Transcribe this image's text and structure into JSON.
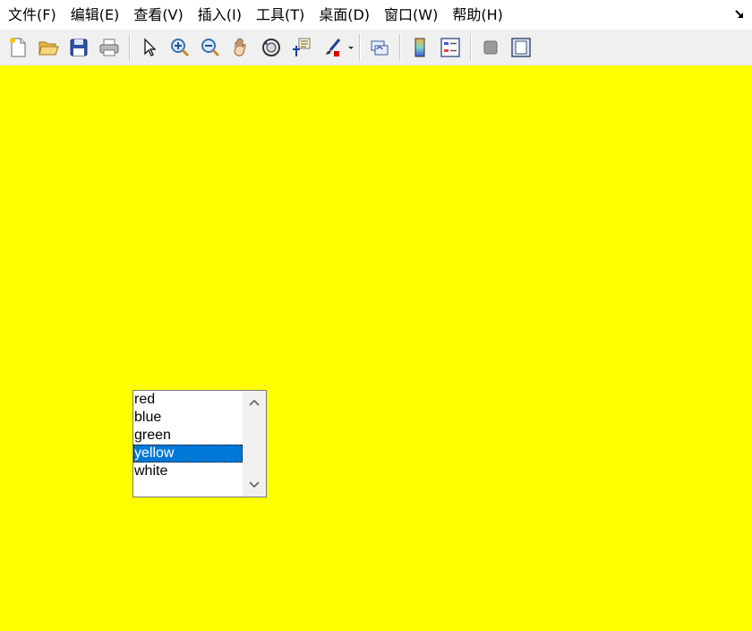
{
  "menubar": {
    "items": [
      {
        "label": "文件(F)"
      },
      {
        "label": "编辑(E)"
      },
      {
        "label": "查看(V)"
      },
      {
        "label": "插入(I)"
      },
      {
        "label": "工具(T)"
      },
      {
        "label": "桌面(D)"
      },
      {
        "label": "窗口(W)"
      },
      {
        "label": "帮助(H)"
      }
    ]
  },
  "toolbar": {
    "buttons": [
      "new-figure-icon",
      "open-file-icon",
      "save-icon",
      "print-icon",
      "select-pointer-icon",
      "zoom-in-icon",
      "zoom-out-icon",
      "pan-hand-icon",
      "rotate-3d-icon",
      "data-cursor-icon",
      "brush-icon",
      "link-plot-icon",
      "colorbar-icon",
      "legend-icon",
      "hide-plot-tools-icon",
      "show-plot-tools-icon"
    ]
  },
  "canvas": {
    "background": "#ffff00"
  },
  "listbox": {
    "items": [
      "red",
      "blue",
      "green",
      "yellow",
      "white"
    ],
    "selected": "yellow",
    "selected_color": "#0078d7"
  }
}
